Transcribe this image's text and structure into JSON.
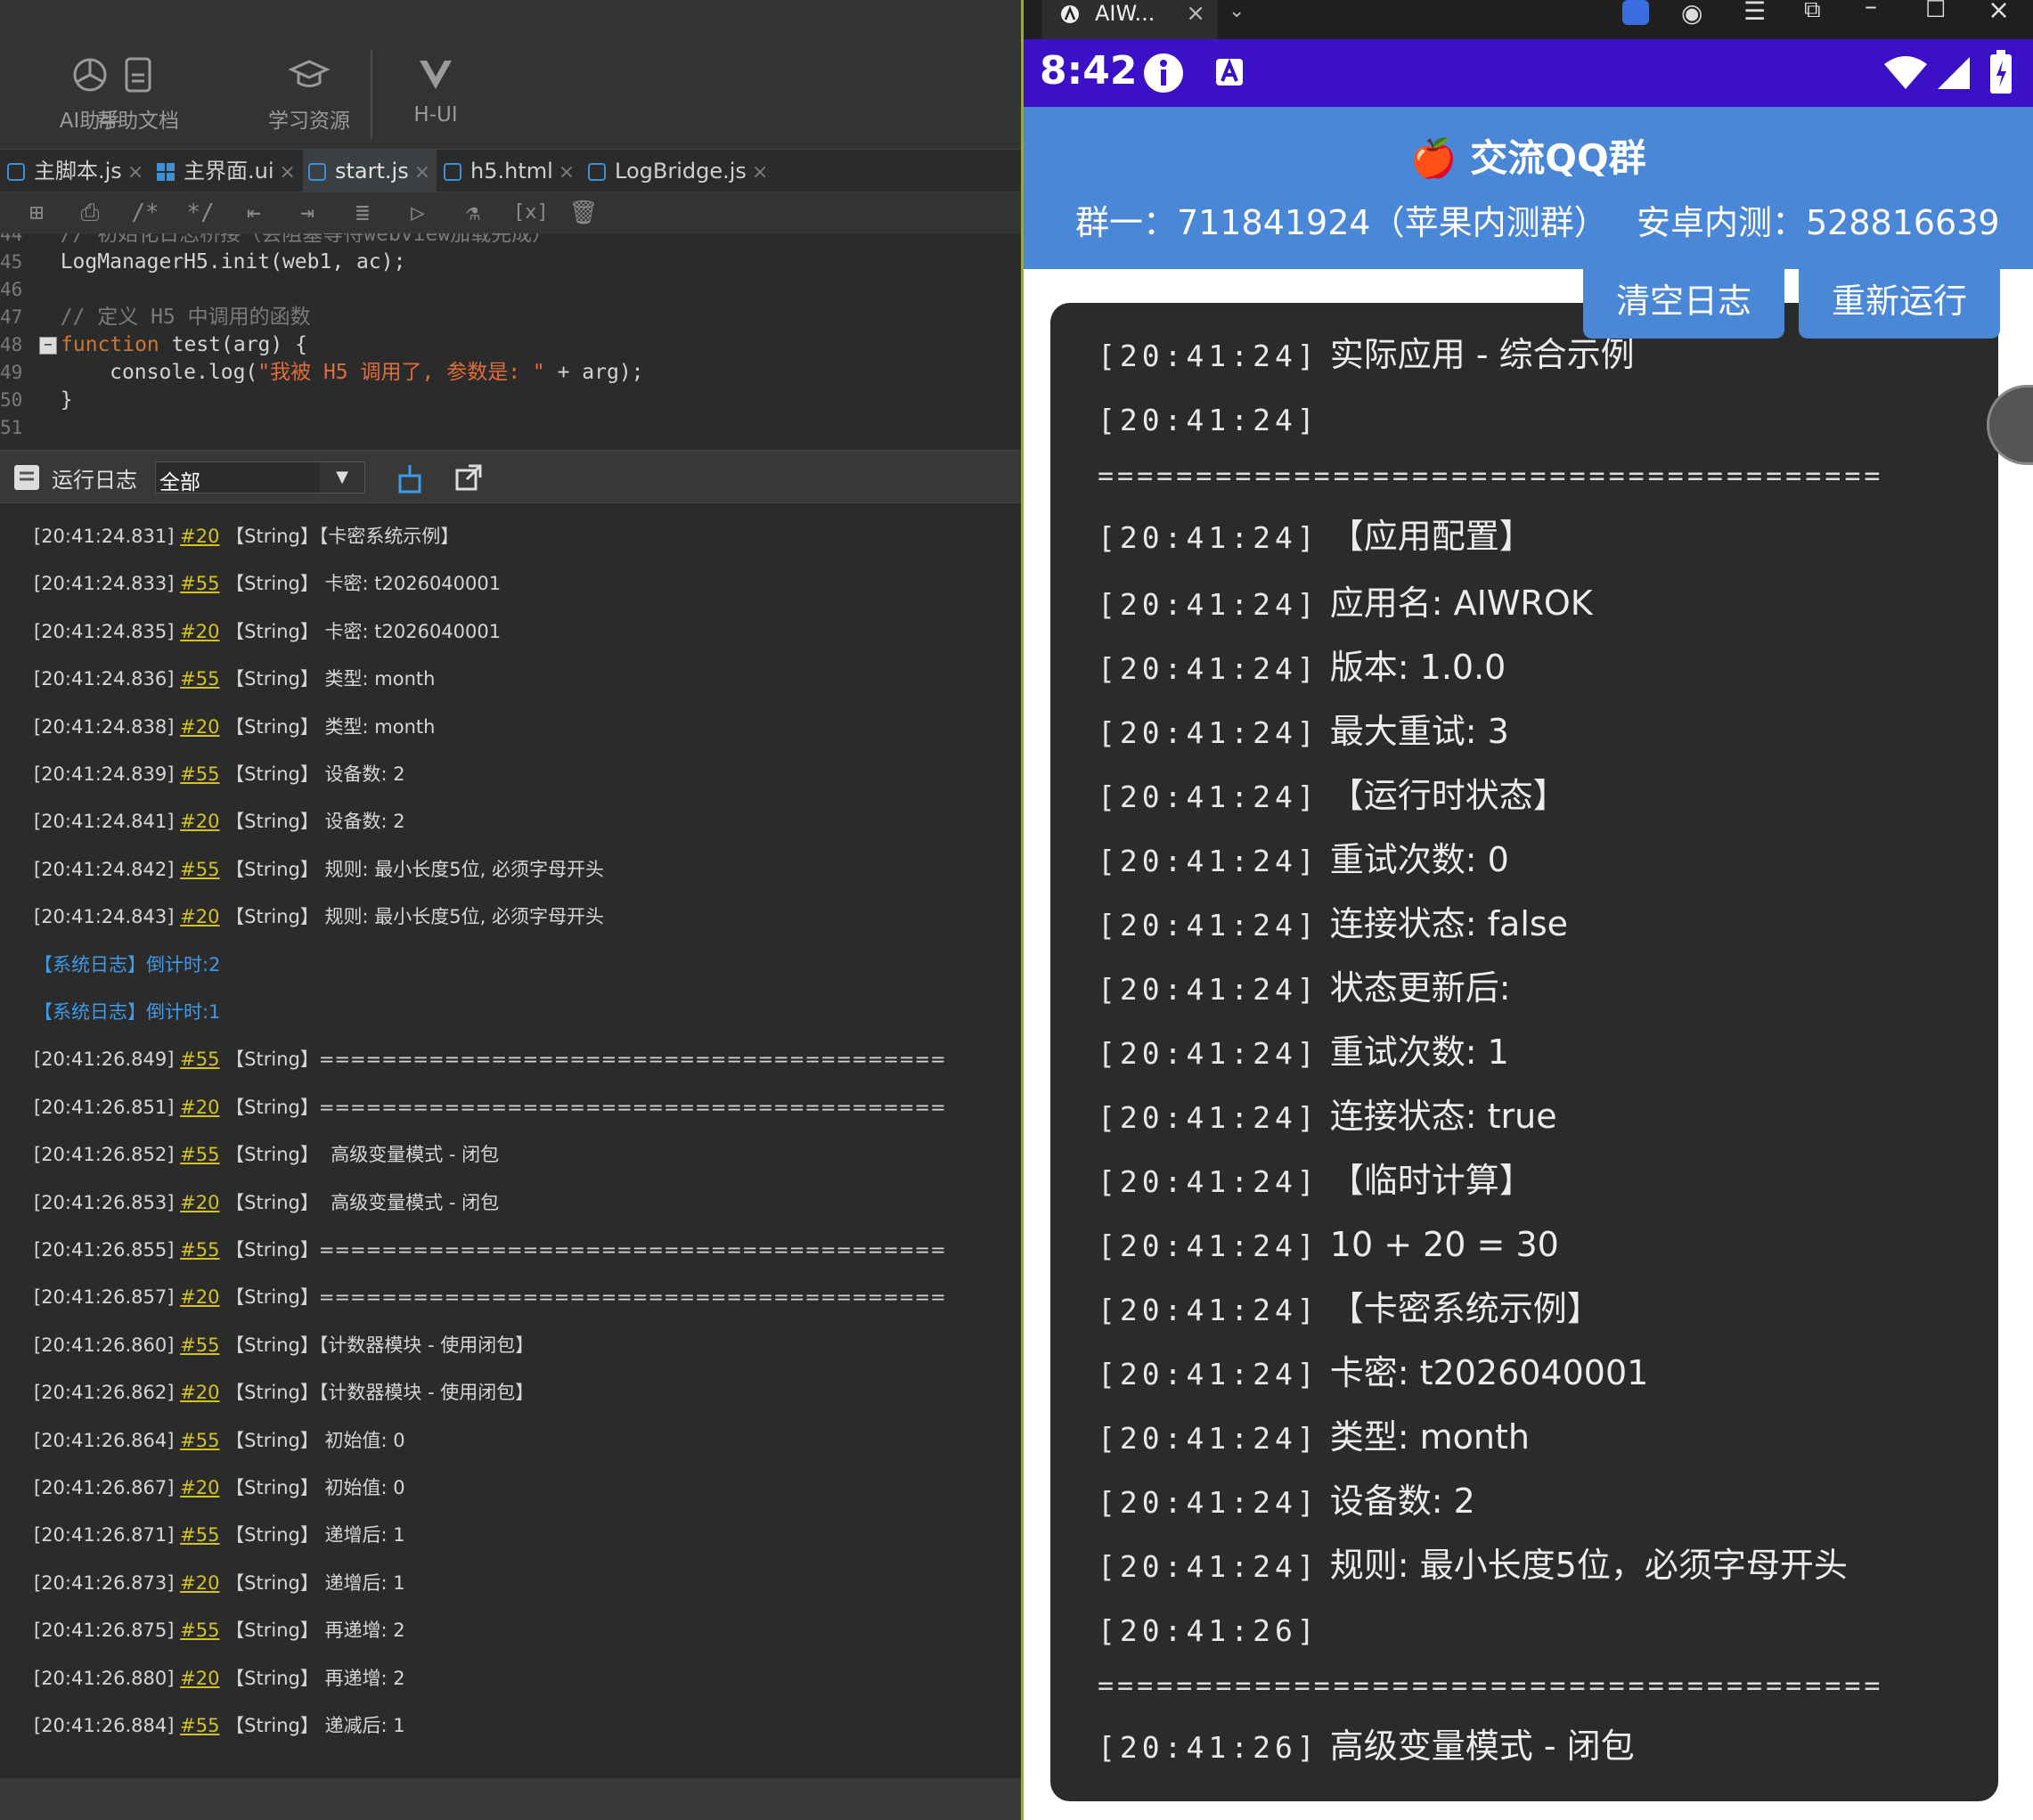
{
  "toolbar": {
    "items": [
      {
        "icon": "openai-icon",
        "label": "AI助手"
      },
      {
        "icon": "document-icon",
        "label": "帮助文档"
      },
      {
        "icon": "graduation-cap-icon",
        "label": "学习资源"
      },
      {
        "icon": "vue-icon",
        "label": "H-UI"
      }
    ]
  },
  "tabs": [
    {
      "label": "主脚本.js",
      "active": false
    },
    {
      "label": "主界面.ui",
      "active": false
    },
    {
      "label": "start.js",
      "active": true
    },
    {
      "label": "h5.html",
      "active": false
    },
    {
      "label": "LogBridge.js",
      "active": false
    }
  ],
  "code_lines": [
    {
      "num": "44",
      "text": "// 初始化日志桥接（会阻塞等待webview加载完成）"
    },
    {
      "num": "45",
      "text": "LogManagerH5.init(web1, ac);"
    },
    {
      "num": "46",
      "text": ""
    },
    {
      "num": "47",
      "text": "// 定义 H5 中调用的函数"
    },
    {
      "num": "48",
      "kw": "function",
      "rest": " test(arg) {"
    },
    {
      "num": "49",
      "pre": "    console.log(",
      "str": "\"我被 H5 调用了, 参数是: \"",
      "post": " + arg);"
    },
    {
      "num": "50",
      "text": "}"
    },
    {
      "num": "51",
      "text": ""
    }
  ],
  "logbar": {
    "title": "运行日志",
    "filter_value": "全部"
  },
  "log_rows": [
    {
      "ts": "[20:41:24.831]",
      "ref": "#20",
      "type": "【String】",
      "msg": "【卡密系统示例】"
    },
    {
      "ts": "[20:41:24.833]",
      "ref": "#55",
      "type": "【String】",
      "msg": " 卡密: t2026040001"
    },
    {
      "ts": "[20:41:24.835]",
      "ref": "#20",
      "type": "【String】",
      "msg": " 卡密: t2026040001"
    },
    {
      "ts": "[20:41:24.836]",
      "ref": "#55",
      "type": "【String】",
      "msg": " 类型: month"
    },
    {
      "ts": "[20:41:24.838]",
      "ref": "#20",
      "type": "【String】",
      "msg": " 类型: month"
    },
    {
      "ts": "[20:41:24.839]",
      "ref": "#55",
      "type": "【String】",
      "msg": " 设备数: 2"
    },
    {
      "ts": "[20:41:24.841]",
      "ref": "#20",
      "type": "【String】",
      "msg": " 设备数: 2"
    },
    {
      "ts": "[20:41:24.842]",
      "ref": "#55",
      "type": "【String】",
      "msg": " 规则: 最小长度5位, 必须字母开头"
    },
    {
      "ts": "[20:41:24.843]",
      "ref": "#20",
      "type": "【String】",
      "msg": " 规则: 最小长度5位, 必须字母开头"
    },
    {
      "sys": "【系统日志】倒计时:2"
    },
    {
      "sys": "【系统日志】倒计时:1"
    },
    {
      "ts": "[20:41:26.849]",
      "ref": "#55",
      "type": "【String】",
      "msg": "========================================"
    },
    {
      "ts": "[20:41:26.851]",
      "ref": "#20",
      "type": "【String】",
      "msg": "========================================"
    },
    {
      "ts": "[20:41:26.852]",
      "ref": "#55",
      "type": "【String】",
      "msg": "  高级变量模式 - 闭包"
    },
    {
      "ts": "[20:41:26.853]",
      "ref": "#20",
      "type": "【String】",
      "msg": "  高级变量模式 - 闭包"
    },
    {
      "ts": "[20:41:26.855]",
      "ref": "#55",
      "type": "【String】",
      "msg": "========================================"
    },
    {
      "ts": "[20:41:26.857]",
      "ref": "#20",
      "type": "【String】",
      "msg": "========================================"
    },
    {
      "ts": "[20:41:26.860]",
      "ref": "#55",
      "type": "【String】",
      "msg": "【计数器模块 - 使用闭包】"
    },
    {
      "ts": "[20:41:26.862]",
      "ref": "#20",
      "type": "【String】",
      "msg": "【计数器模块 - 使用闭包】"
    },
    {
      "ts": "[20:41:26.864]",
      "ref": "#55",
      "type": "【String】",
      "msg": " 初始值: 0"
    },
    {
      "ts": "[20:41:26.867]",
      "ref": "#20",
      "type": "【String】",
      "msg": " 初始值: 0"
    },
    {
      "ts": "[20:41:26.871]",
      "ref": "#55",
      "type": "【String】",
      "msg": " 递增后: 1"
    },
    {
      "ts": "[20:41:26.873]",
      "ref": "#20",
      "type": "【String】",
      "msg": " 递增后: 1"
    },
    {
      "ts": "[20:41:26.875]",
      "ref": "#55",
      "type": "【String】",
      "msg": " 再递增: 2"
    },
    {
      "ts": "[20:41:26.880]",
      "ref": "#20",
      "type": "【String】",
      "msg": " 再递增: 2"
    },
    {
      "ts": "[20:41:26.884]",
      "ref": "#55",
      "type": "【String】",
      "msg": " 递减后: 1"
    }
  ],
  "emulator": {
    "window_tab": "AIW...",
    "status_time": "8:42",
    "status_icons": [
      "info-icon",
      "a-icon",
      "wifi-icon",
      "signal-icon",
      "battery-icon"
    ],
    "header_title": "交流QQ群",
    "header_emoji": "🍎",
    "group1": "群一：711841924（苹果内测群）",
    "group2": "安卓内测：528816639",
    "btn_clear": "清空日志",
    "btn_rerun": "重新运行",
    "colors": {
      "status": "#3c10c6",
      "header": "#4a87d6",
      "panel": "#2b2b2b"
    }
  },
  "panel_lines": [
    {
      "ts": "[20:41:24]",
      "msg": " 实际应用 - 综合示例"
    },
    {
      "ts": "[20:41:24]",
      "msg": ""
    },
    {
      "sep": "========================================"
    },
    {
      "ts": "[20:41:24]",
      "msg": " 【应用配置】"
    },
    {
      "ts": "[20:41:24]",
      "msg": " 应用名: AIWROK"
    },
    {
      "ts": "[20:41:24]",
      "msg": " 版本: 1.0.0"
    },
    {
      "ts": "[20:41:24]",
      "msg": " 最大重试: 3"
    },
    {
      "ts": "[20:41:24]",
      "msg": " 【运行时状态】"
    },
    {
      "ts": "[20:41:24]",
      "msg": " 重试次数: 0"
    },
    {
      "ts": "[20:41:24]",
      "msg": " 连接状态: false"
    },
    {
      "ts": "[20:41:24]",
      "msg": " 状态更新后:"
    },
    {
      "ts": "[20:41:24]",
      "msg": " 重试次数: 1"
    },
    {
      "ts": "[20:41:24]",
      "msg": " 连接状态: true"
    },
    {
      "ts": "[20:41:24]",
      "msg": " 【临时计算】"
    },
    {
      "ts": "[20:41:24]",
      "msg": " 10 + 20 = 30"
    },
    {
      "ts": "[20:41:24]",
      "msg": " 【卡密系统示例】"
    },
    {
      "ts": "[20:41:24]",
      "msg": " 卡密: t2026040001"
    },
    {
      "ts": "[20:41:24]",
      "msg": " 类型: month"
    },
    {
      "ts": "[20:41:24]",
      "msg": " 设备数: 2"
    },
    {
      "ts": "[20:41:24]",
      "msg": " 规则: 最小长度5位，必须字母开头"
    },
    {
      "ts": "[20:41:26]",
      "msg": ""
    },
    {
      "sep": "========================================"
    },
    {
      "ts": "[20:41:26]",
      "msg": " 高级变量模式 - 闭包"
    }
  ]
}
